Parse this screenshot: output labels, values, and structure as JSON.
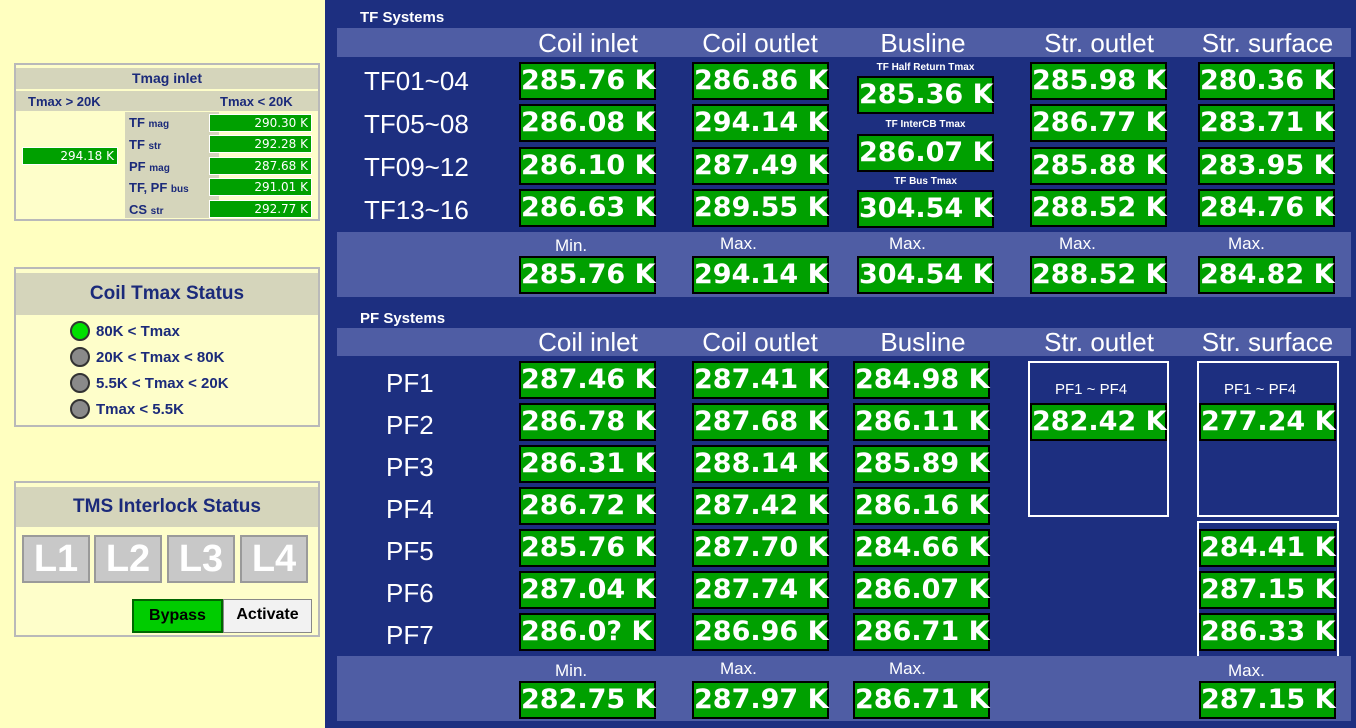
{
  "tmag": {
    "title": "Tmag inlet",
    "left_header": "Tmax > 20K",
    "right_header": "Tmax < 20K",
    "left_value": "294.18 K",
    "labels": [
      "TF mag",
      "TF str",
      "PF mag",
      "TF, PF bus",
      "CS str"
    ],
    "values": [
      "290.30 K",
      "292.28 K",
      "287.68 K",
      "291.01 K",
      "292.77 K"
    ]
  },
  "coil_status": {
    "title": "Coil Tmax Status",
    "items": [
      {
        "text": "80K < Tmax",
        "color": "#00e000"
      },
      {
        "text": "20K < Tmax < 80K",
        "color": "#8a8a8a"
      },
      {
        "text": "5.5K < Tmax < 20K",
        "color": "#8a8a8a"
      },
      {
        "text": "Tmax < 5.5K",
        "color": "#8a8a8a"
      }
    ]
  },
  "interlock": {
    "title": "TMS Interlock Status",
    "levels": [
      "L1",
      "L2",
      "L3",
      "L4"
    ],
    "bypass": "Bypass",
    "activate": "Activate"
  },
  "tf": {
    "section": "TF Systems",
    "columns": [
      "Coil inlet",
      "Coil outlet",
      "Busline",
      "Str. outlet",
      "Str. surface"
    ],
    "rows": [
      "TF01~04",
      "TF05~08",
      "TF09~12",
      "TF13~16"
    ],
    "coil_inlet": [
      "285.76 K",
      "286.08 K",
      "286.10 K",
      "286.63 K"
    ],
    "coil_outlet": [
      "286.86 K",
      "294.14 K",
      "287.49 K",
      "289.55 K"
    ],
    "busline_labels": [
      "TF Half Return Tmax",
      "TF InterCB Tmax",
      "TF Bus Tmax"
    ],
    "busline": [
      "285.36 K",
      "286.07 K",
      "304.54 K"
    ],
    "str_outlet": [
      "285.98 K",
      "286.77 K",
      "285.88 K",
      "288.52 K"
    ],
    "str_surface": [
      "280.36 K",
      "283.71 K",
      "283.95 K",
      "284.76 K"
    ],
    "summary_labels": [
      "Min.",
      "Max.",
      "Max.",
      "Max.",
      "Max."
    ],
    "summary": [
      "285.76 K",
      "294.14 K",
      "304.54 K",
      "288.52 K",
      "284.82 K"
    ]
  },
  "pf": {
    "section": "PF Systems",
    "columns": [
      "Coil inlet",
      "Coil outlet",
      "Busline",
      "Str. outlet",
      "Str. surface"
    ],
    "rows": [
      "PF1",
      "PF2",
      "PF3",
      "PF4",
      "PF5",
      "PF6",
      "PF7"
    ],
    "coil_inlet": [
      "287.46 K",
      "286.78 K",
      "286.31 K",
      "286.72 K",
      "285.76 K",
      "287.04 K",
      "286.0? K"
    ],
    "coil_outlet": [
      "287.41 K",
      "287.68 K",
      "288.14 K",
      "287.42 K",
      "287.70 K",
      "287.74 K",
      "286.96 K"
    ],
    "busline": [
      "284.98 K",
      "286.11 K",
      "285.89 K",
      "286.16 K",
      "284.66 K",
      "286.07 K",
      "286.71 K"
    ],
    "str_outlet_label": "PF1 ~ PF4",
    "str_outlet": "282.42 K",
    "str_surface_label": "PF1 ~ PF4",
    "str_surface": [
      "277.24 K",
      "284.41 K",
      "287.15 K",
      "286.33 K"
    ],
    "summary_labels": [
      "Min.",
      "Max.",
      "Max.",
      "Max."
    ],
    "summary": [
      "282.75 K",
      "287.97 K",
      "286.71 K",
      "287.15 K"
    ]
  }
}
